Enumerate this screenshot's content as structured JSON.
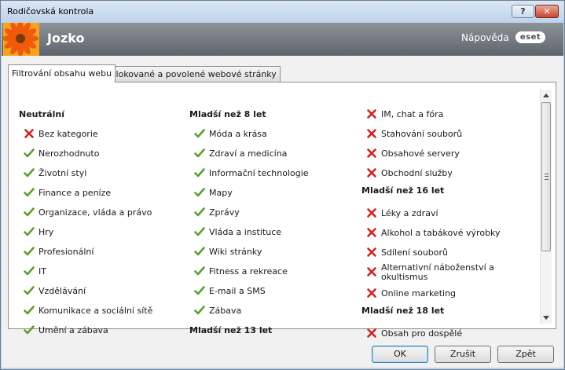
{
  "window": {
    "title": "Rodičovská kontrola",
    "help_button": "?",
    "close_button": "✕"
  },
  "header": {
    "user_name": "Jozko",
    "help_link": "Nápověda",
    "logo_text": "eset"
  },
  "tabs": [
    {
      "label": "Filtrování obsahu webu",
      "active": true
    },
    {
      "label": "Blokované a povolené webové stránky",
      "active": false
    }
  ],
  "columns": [
    [
      {
        "type": "header",
        "label": "Neutrální"
      },
      {
        "type": "item",
        "label": "Bez kategorie",
        "allowed": false
      },
      {
        "type": "item",
        "label": "Nerozhodnuto",
        "allowed": true
      },
      {
        "type": "item",
        "label": "Životní styl",
        "allowed": true
      },
      {
        "type": "item",
        "label": "Finance a peníze",
        "allowed": true
      },
      {
        "type": "item",
        "label": "Organizace, vláda a právo",
        "allowed": true
      },
      {
        "type": "item",
        "label": "Hry",
        "allowed": true
      },
      {
        "type": "item",
        "label": "Profesionální",
        "allowed": true
      },
      {
        "type": "item",
        "label": "IT",
        "allowed": true
      },
      {
        "type": "item",
        "label": "Vzdělávání",
        "allowed": true
      },
      {
        "type": "item",
        "label": "Komunikace a sociální sítě",
        "allowed": true
      },
      {
        "type": "item",
        "label": "Umění a zábava",
        "allowed": true
      }
    ],
    [
      {
        "type": "header",
        "label": "Mladší než 8 let"
      },
      {
        "type": "item",
        "label": "Móda a krása",
        "allowed": true
      },
      {
        "type": "item",
        "label": "Zdraví a medicína",
        "allowed": true
      },
      {
        "type": "item",
        "label": "Informační technologie",
        "allowed": true
      },
      {
        "type": "item",
        "label": "Mapy",
        "allowed": true
      },
      {
        "type": "item",
        "label": "Zprávy",
        "allowed": true
      },
      {
        "type": "item",
        "label": "Vláda a instituce",
        "allowed": true
      },
      {
        "type": "item",
        "label": "Wiki stránky",
        "allowed": true
      },
      {
        "type": "item",
        "label": "Fitness a rekreace",
        "allowed": true
      },
      {
        "type": "item",
        "label": "E-mail a SMS",
        "allowed": true
      },
      {
        "type": "item",
        "label": "Zábava",
        "allowed": true
      },
      {
        "type": "header",
        "label": "Mladší než 13 let"
      }
    ],
    [
      {
        "type": "item",
        "label": "IM, chat a fóra",
        "allowed": false
      },
      {
        "type": "item",
        "label": "Stahování souborů",
        "allowed": false
      },
      {
        "type": "item",
        "label": "Obsahové servery",
        "allowed": false
      },
      {
        "type": "item",
        "label": "Obchodní služby",
        "allowed": false
      },
      {
        "type": "header",
        "label": "Mladší než 16 let"
      },
      {
        "type": "item",
        "label": "Léky a zdraví",
        "allowed": false
      },
      {
        "type": "item",
        "label": "Alkohol a tabákové výrobky",
        "allowed": false
      },
      {
        "type": "item",
        "label": "Sdílení souborů",
        "allowed": false
      },
      {
        "type": "item",
        "label": "Alternativní náboženství a okultismus",
        "allowed": false,
        "wrap": true
      },
      {
        "type": "item",
        "label": "Online marketing",
        "allowed": false
      },
      {
        "type": "header",
        "label": "Mladší než 18 let"
      },
      {
        "type": "item",
        "label": "Obsah pro dospělé",
        "allowed": false
      }
    ]
  ],
  "buttons": {
    "ok": "OK",
    "cancel": "Zrušit",
    "back": "Zpět"
  },
  "colors": {
    "allowed": "#5aa02c",
    "blocked": "#d42020"
  }
}
